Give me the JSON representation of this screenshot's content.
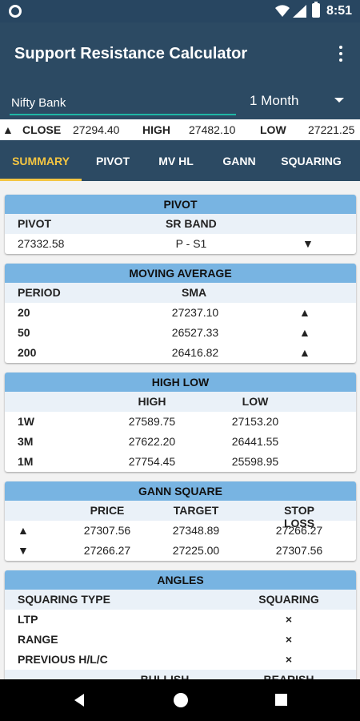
{
  "status": {
    "time": "8:51"
  },
  "app": {
    "title": "Support Resistance Calculator"
  },
  "search": {
    "symbol_value": "Nifty Bank",
    "period": "1 Month"
  },
  "ticker": {
    "arrow": "▲",
    "close_label": "CLOSE",
    "close_value": "27294.40",
    "high_label": "HIGH",
    "high_value": "27482.10",
    "low_label": "LOW",
    "low_value": "27221.25"
  },
  "tabs": [
    "SUMMARY",
    "PIVOT",
    "MV HL",
    "GANN",
    "SQUARING"
  ],
  "pivot": {
    "title": "PIVOT",
    "col1": "PIVOT",
    "col2": "SR BAND",
    "value": "27332.58",
    "band": "P - S1",
    "arrow": "▼"
  },
  "moving_average": {
    "title": "MOVING AVERAGE",
    "col1": "PERIOD",
    "col2": "SMA",
    "rows": [
      {
        "period": "20",
        "sma": "27237.10",
        "trend": "▲"
      },
      {
        "period": "50",
        "sma": "26527.33",
        "trend": "▲"
      },
      {
        "period": "200",
        "sma": "26416.82",
        "trend": "▲"
      }
    ]
  },
  "high_low": {
    "title": "HIGH LOW",
    "col_high": "HIGH",
    "col_low": "LOW",
    "rows": [
      {
        "period": "1W",
        "high": "27589.75",
        "low": "27153.20"
      },
      {
        "period": "3M",
        "high": "27622.20",
        "low": "26441.55"
      },
      {
        "period": "1M",
        "high": "27754.45",
        "low": "25598.95"
      }
    ]
  },
  "gann": {
    "title": "GANN SQUARE",
    "col_price": "PRICE",
    "col_target": "TARGET",
    "col_stop": "STOP LOSS",
    "rows": [
      {
        "dir": "▲",
        "price": "27307.56",
        "target": "27348.89",
        "stop": "27266.27"
      },
      {
        "dir": "▼",
        "price": "27266.27",
        "target": "27225.00",
        "stop": "27307.56"
      }
    ]
  },
  "angles": {
    "title": "ANGLES",
    "col_type": "SQUARING TYPE",
    "col_squaring": "SQUARING",
    "rows": [
      {
        "type": "LTP",
        "value": "×"
      },
      {
        "type": "RANGE",
        "value": "×"
      },
      {
        "type": "PREVIOUS H/L/C",
        "value": "×"
      }
    ],
    "col_bullish": "BULLISH",
    "col_bearish": "BEARISH"
  },
  "colors": {
    "primary": "#2c4a63",
    "accent": "#f4c542",
    "card_header": "#78b4e2",
    "input_underline": "#1fb7a5"
  }
}
